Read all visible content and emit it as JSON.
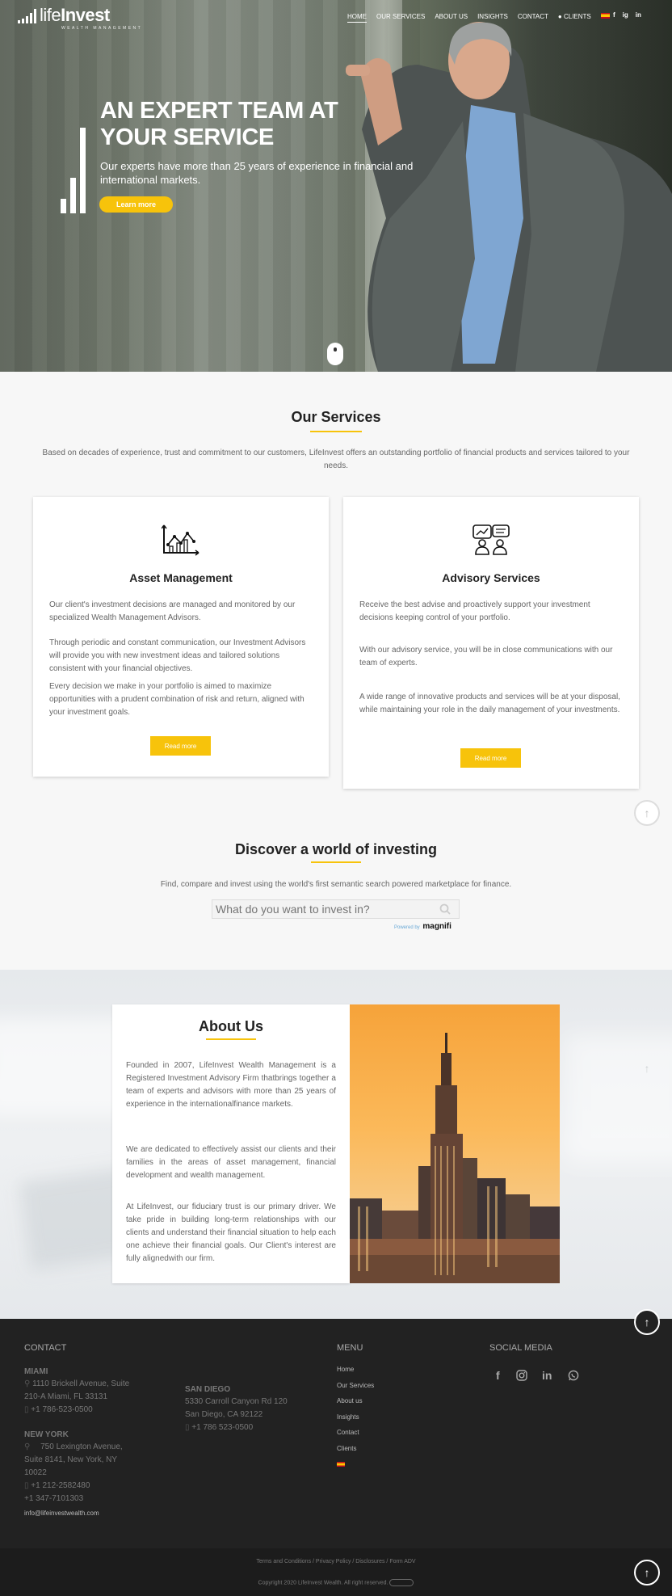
{
  "nav": {
    "logo_light": "life",
    "logo_bold": "Invest",
    "logo_tagline": "WEALTH MANAGEMENT",
    "items": [
      "HOME",
      "OUR SERVICES",
      "ABOUT US",
      "INSIGHTS",
      "CONTACT"
    ],
    "clients": "CLIENTS",
    "social": [
      "f",
      "ig",
      "in"
    ]
  },
  "hero": {
    "title": "AN EXPERT TEAM AT YOUR SERVICE",
    "subtitle": "Our experts have more than 25 years of experience in financial and international markets.",
    "button": "Learn more"
  },
  "services": {
    "title": "Our Services",
    "intro": "Based on decades of experience, trust and commitment to our customers, LifeInvest offers an outstanding portfolio of financial products and services tailored to your needs.",
    "cards": [
      {
        "title": "Asset Management",
        "paragraphs": [
          "Our client's investment decisions are managed and monitored by our specialized Wealth Management Advisors.",
          "Through periodic and constant communication, our Investment Advisors will provide you with new investment ideas and tailored solutions consistent with your financial objectives.",
          "Every decision we make in your portfolio is aimed to maximize opportunities with a prudent combination of risk and return, aligned with your investment goals."
        ],
        "button": "Read more"
      },
      {
        "title": "Advisory Services",
        "paragraphs": [
          "Receive the best advise and proactively support your investment decisions keeping control of your portfolio.",
          "With our advisory service, you will be in close communications with our team of experts.",
          "A wide range of innovative products and services will be at your disposal, while maintaining your role in the daily management of your investments."
        ],
        "button": "Read more"
      }
    ]
  },
  "discover": {
    "title": "Discover a world of investing",
    "intro": "Find, compare and invest using the world's first semantic search powered marketplace for finance.",
    "placeholder": "What do you want to invest in?",
    "powered_by": "Powered by",
    "brand": "magnifi"
  },
  "about": {
    "title": "About Us",
    "paragraphs": [
      "Founded in 2007, LifeInvest Wealth Management is a Registered Investment Advisory Firm thatbrings together a team of experts and advisors with more than 25 years of experience in the internationalfinance markets.",
      "We are dedicated to effectively assist our clients and their families in the areas of asset management, financial development and wealth management.",
      "At LifeInvest, our fiduciary trust is our primary driver. We take pride in building long-term relationships with our clients and understand their financial situation to help each one achieve their financial goals. Our Client's interest are fully alignedwith our firm."
    ]
  },
  "footer": {
    "contact_heading": "CONTACT",
    "miami": {
      "city": "MIAMI",
      "address1": "1110 Brickell Avenue, Suite",
      "address2": "210-A Miami, FL 33131",
      "phone": "+1 786-523-0500"
    },
    "san_diego": {
      "city": "SAN DIEGO",
      "address1": "5330 Carroll Canyon Rd 120",
      "address2": "San Diego, CA 92122",
      "phone": "+1 786 523-0500"
    },
    "new_york": {
      "city": "NEW YORK",
      "address1": "750 Lexington Avenue,",
      "address2": "Suite 8141, New York, NY",
      "address3": "10022",
      "phone1": "+1 212-2582480",
      "phone2": "+1 347-7101303"
    },
    "email": "info@lifeinvestwealth.com",
    "menu_heading": "MENU",
    "menu": [
      "Home",
      "Our Services",
      "About us",
      "Insights",
      "Contact",
      "Clients"
    ],
    "social_heading": "SOCIAL MEDIA",
    "social_icons": [
      "facebook-icon",
      "instagram-icon",
      "linkedin-icon",
      "whatsapp-icon"
    ]
  },
  "subfooter": {
    "links": "Terms and Conditions / Privacy Policy / Disclosures / Form ADV",
    "copyright": "Copyright 2020 LifeInvest Wealth. All right reserved."
  },
  "colors": {
    "accent": "#f7c30b",
    "footer_bg": "#222222"
  }
}
